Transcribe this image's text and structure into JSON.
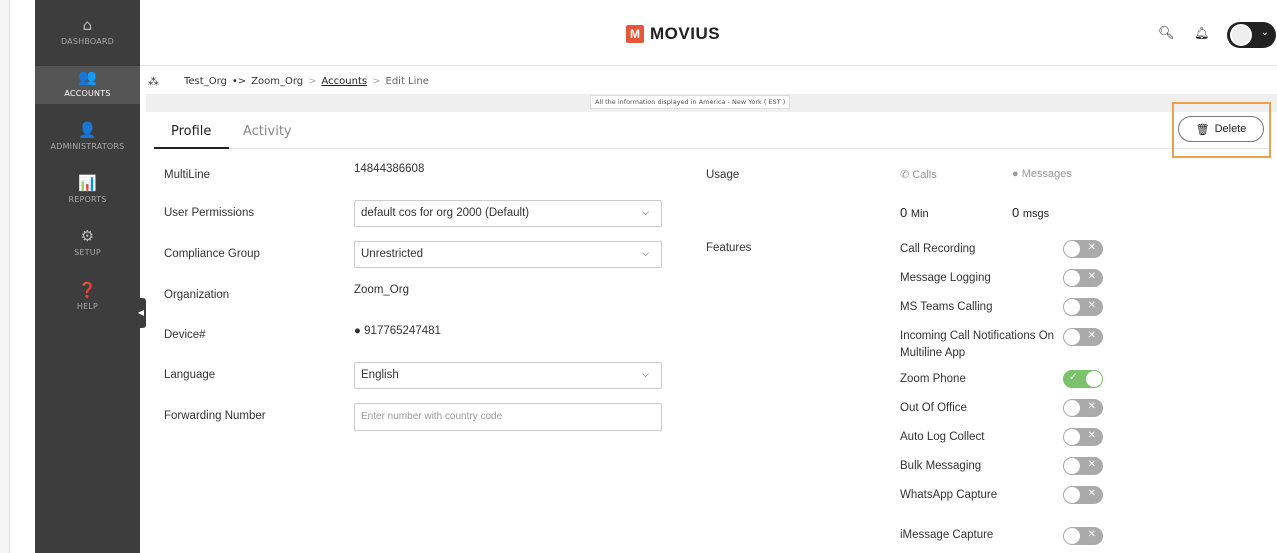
{
  "sidebar": {
    "items": [
      {
        "label": "DASHBOARD",
        "icon": "home-icon",
        "glyph": "⌂"
      },
      {
        "label": "ACCOUNTS",
        "icon": "users-icon",
        "glyph": "👥"
      },
      {
        "label": "ADMINISTRATORS",
        "icon": "admin-icon",
        "glyph": "👤"
      },
      {
        "label": "REPORTS",
        "icon": "reports-icon",
        "glyph": "📊"
      },
      {
        "label": "SETUP",
        "icon": "gear-icon",
        "glyph": "⚙"
      },
      {
        "label": "HELP",
        "icon": "help-icon",
        "glyph": "❓"
      }
    ],
    "active": "ACCOUNTS"
  },
  "header": {
    "logo_mark": "M",
    "logo_text": "MOVIUS"
  },
  "breadcrumb": {
    "org": "Test_Org",
    "arrow": "•>",
    "sub_org": "Zoom_Org",
    "accounts": "Accounts",
    "current": "Edit Line"
  },
  "timezone_note": "All the information displayed in America - New York ( EST )",
  "tabs": {
    "profile": "Profile",
    "activity": "Activity"
  },
  "delete_label": "Delete",
  "form": {
    "multiline_label": "MultiLine",
    "multiline_value": "14844386608",
    "permissions_label": "User Permissions",
    "permissions_value": "default cos for org 2000 (Default)",
    "compliance_label": "Compliance Group",
    "compliance_value": "Unrestricted",
    "organization_label": "Organization",
    "organization_value": "Zoom_Org",
    "device_label": "Device#",
    "device_value": "917765247481",
    "language_label": "Language",
    "language_value": "English",
    "forwarding_label": "Forwarding Number",
    "forwarding_placeholder": "Enter number with country code"
  },
  "usage": {
    "label": "Usage",
    "calls_head": "Calls",
    "messages_head": "Messages",
    "calls_value": "0",
    "calls_unit": "Min",
    "messages_value": "0",
    "messages_unit": "msgs"
  },
  "features": {
    "label": "Features",
    "items": [
      {
        "name": "Call Recording",
        "enabled": false
      },
      {
        "name": "Message Logging",
        "enabled": false
      },
      {
        "name": "MS Teams Calling",
        "enabled": false
      },
      {
        "name": "Incoming Call Notifications On Multiline App",
        "enabled": false
      },
      {
        "name": "Zoom Phone",
        "enabled": true
      },
      {
        "name": "Out Of Office",
        "enabled": false
      },
      {
        "name": "Auto Log Collect",
        "enabled": false
      },
      {
        "name": "Bulk Messaging",
        "enabled": false
      },
      {
        "name": "WhatsApp Capture",
        "enabled": false
      },
      {
        "name": "iMessage Capture",
        "enabled": false
      }
    ]
  }
}
